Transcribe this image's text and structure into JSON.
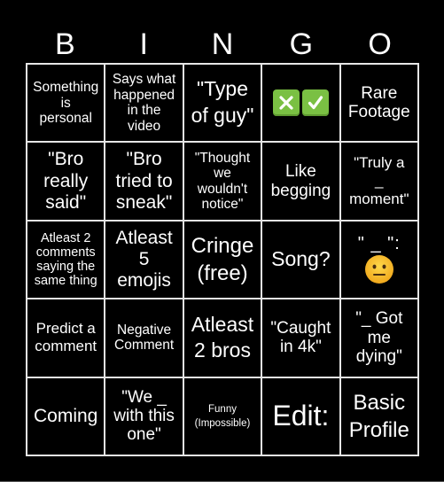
{
  "header": {
    "letters": [
      "B",
      "I",
      "N",
      "G",
      "O"
    ]
  },
  "board": {
    "rows": [
      [
        {
          "text": "Something\nis\npersonal"
        },
        {
          "text": "Says what\nhappened\nin the\nvideo"
        },
        {
          "text": "\"Type\nof guy\""
        },
        {
          "text": "",
          "emoji": [
            "cross-mark-button",
            "check-mark-button"
          ]
        },
        {
          "text": "Rare\nFootage"
        }
      ],
      [
        {
          "text": "\"Bro\nreally\nsaid\""
        },
        {
          "text": "\"Bro\ntried to\nsneak\""
        },
        {
          "text": "\"Thought\nwe\nwouldn't\nnotice\""
        },
        {
          "text": "Like\nbegging"
        },
        {
          "text": "\"Truly a\n_\nmoment\""
        }
      ],
      [
        {
          "text": "Atleast 2\ncomments\nsaying the\nsame thing"
        },
        {
          "text": "Atleast\n5\nemojis"
        },
        {
          "text": "Cringe\n(free)"
        },
        {
          "text": "Song?"
        },
        {
          "text": "\" _ \":",
          "emoji": [
            "neutral-face"
          ]
        }
      ],
      [
        {
          "text": "Predict a\ncomment"
        },
        {
          "text": "Negative\nComment"
        },
        {
          "text": "Atleast\n2 bros"
        },
        {
          "text": "\"Caught\nin 4k\""
        },
        {
          "text": "\"_ Got\nme\ndying\""
        }
      ],
      [
        {
          "text": "Coming"
        },
        {
          "text": "\"We _\nwith this\none\""
        },
        {
          "text": "Funny\n(Impossible)"
        },
        {
          "text": "Edit:"
        },
        {
          "text": "Basic\nProfile"
        }
      ]
    ]
  },
  "colors": {
    "background": "#000000",
    "grid_line": "#e6e6e6",
    "text": "#ffffff",
    "emoji_green": "#7ac043",
    "emoji_face_yellow": "#f7c52b"
  }
}
